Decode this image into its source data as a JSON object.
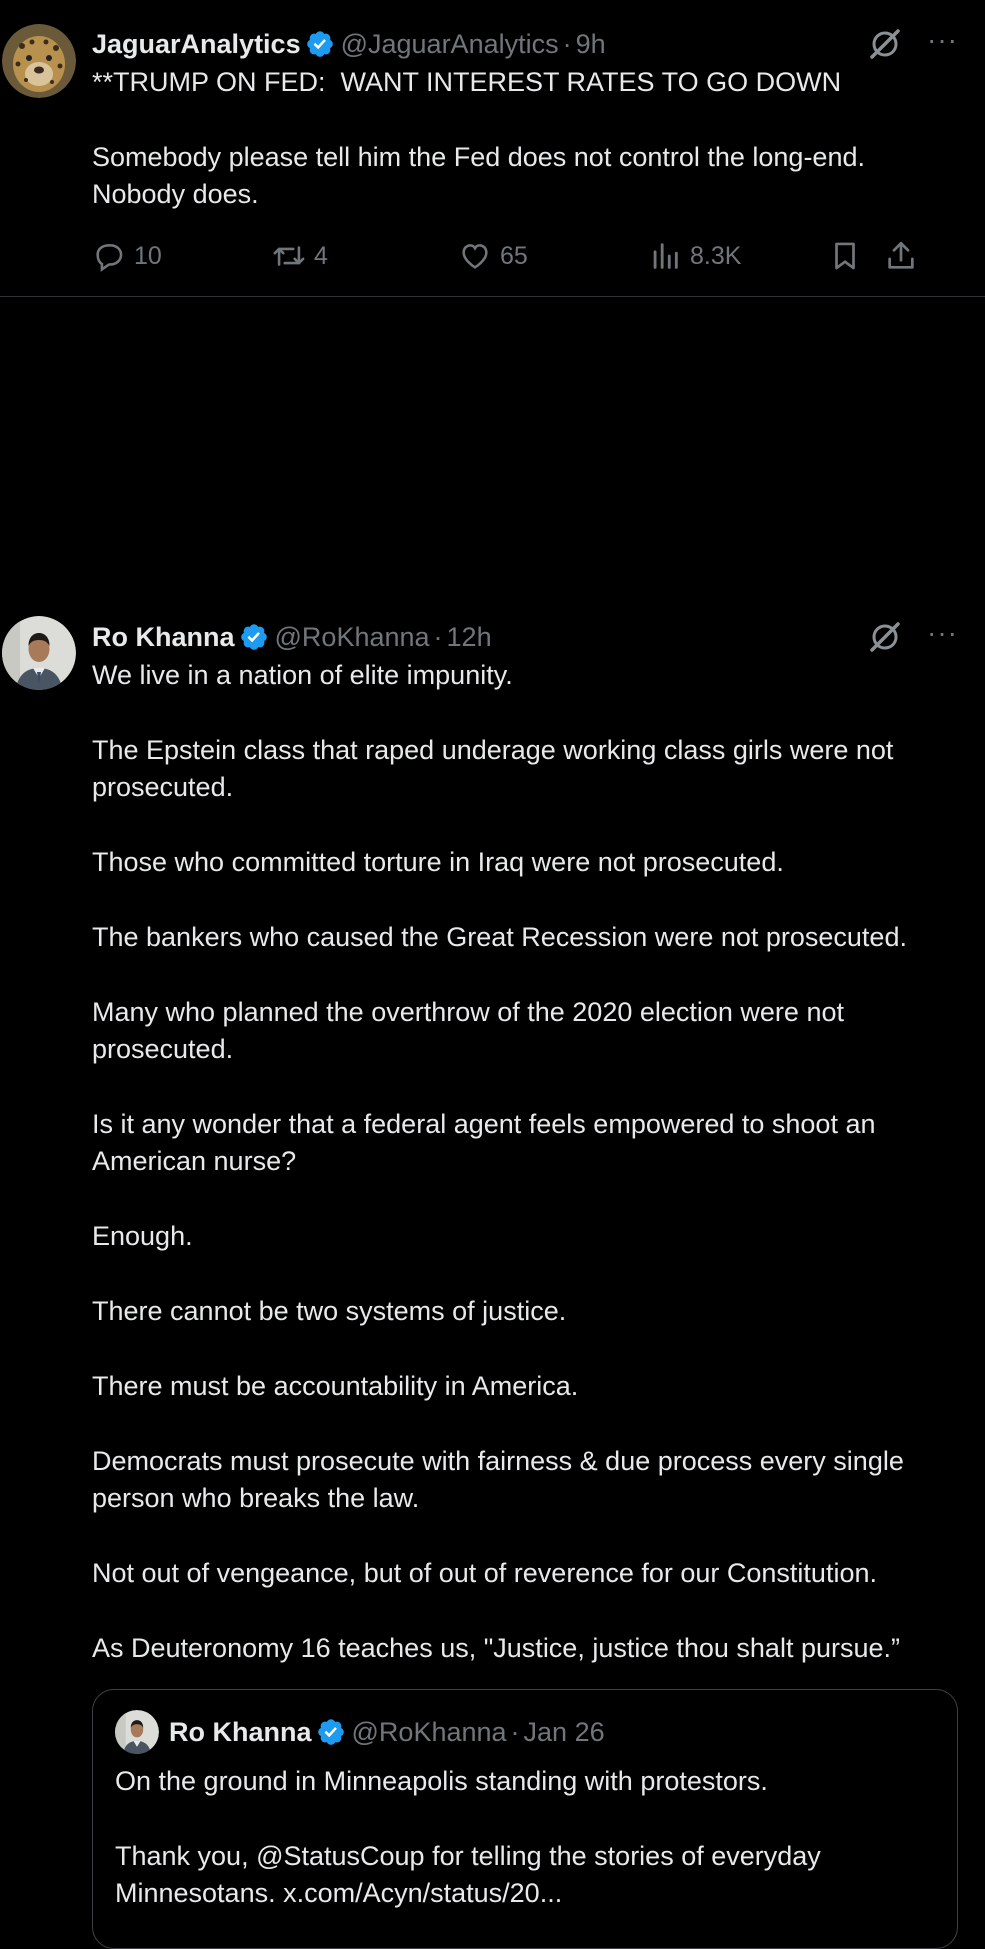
{
  "tweets": [
    {
      "author_name": "JaguarAnalytics",
      "handle": "@JaguarAnalytics",
      "separator": "·",
      "time": "9h",
      "text": "**TRUMP ON FED:  WANT INTEREST RATES TO GO DOWN\n\nSomebody please tell him the Fed does not control the long-end.\nNobody does.",
      "replies": "10",
      "reposts": "4",
      "likes": "65",
      "views": "8.3K",
      "avatar_icon": "jaguar-avatar"
    },
    {
      "author_name": "Ro Khanna",
      "handle": "@RoKhanna",
      "separator": "·",
      "time": "12h",
      "text": "We live in a nation of elite impunity.\n\nThe Epstein class that raped underage working class girls were not\nprosecuted.\n\nThose who committed torture in Iraq were not prosecuted.\n\nThe bankers who caused the Great Recession were not prosecuted.\n\nMany who planned the overthrow of the 2020 election were not\nprosecuted.\n\nIs it any wonder that a federal agent feels empowered to shoot an\nAmerican nurse?\n\nEnough.\n\nThere cannot be two systems of justice.\n\nThere must be accountability in America.\n\nDemocrats must prosecute with fairness & due process every single\nperson who breaks the law.\n\nNot out of vengeance, but of out of reverence for our Constitution.\n\nAs Deuteronomy 16 teaches us, \"Justice, justice thou shalt pursue.”",
      "avatar_icon": "person-avatar",
      "quoted": {
        "author_name": "Ro Khanna",
        "handle": "@RoKhanna",
        "separator": "·",
        "time": "Jan 26",
        "text": "On the ground in Minneapolis standing with protestors.\n\nThank you, @StatusCoup for telling the stories of everyday\nMinnesotans. x.com/Acyn/status/20..."
      }
    }
  ],
  "colors": {
    "background": "#000000",
    "text": "#e7e9ea",
    "muted": "#71767b",
    "verified": "#1d9bf0",
    "border": "#2f3336"
  },
  "icons": {
    "more": "···"
  }
}
